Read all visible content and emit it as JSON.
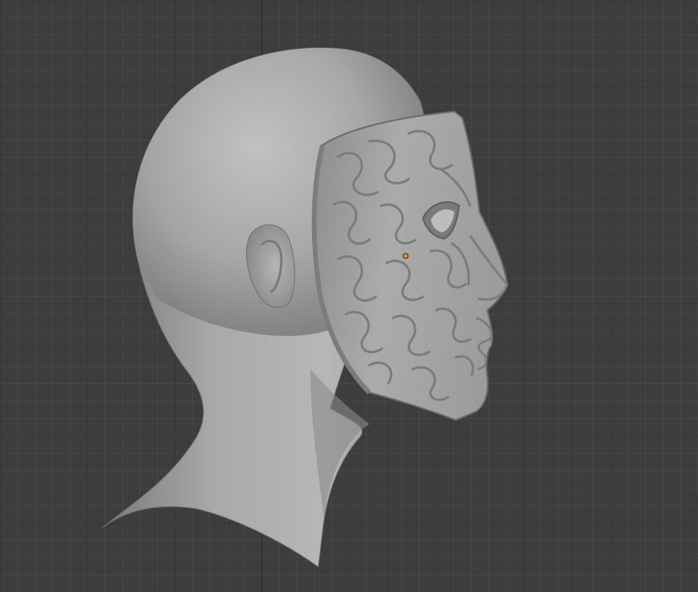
{
  "viewport": {
    "background_color": "#3d3d3d",
    "grid_color": "#353535",
    "axis_color": "#2a2a2a"
  },
  "model": {
    "head_color": "#a9a9a9",
    "mask_color": "#9e9e9e",
    "origin_marker_color": "#f28c1a"
  }
}
